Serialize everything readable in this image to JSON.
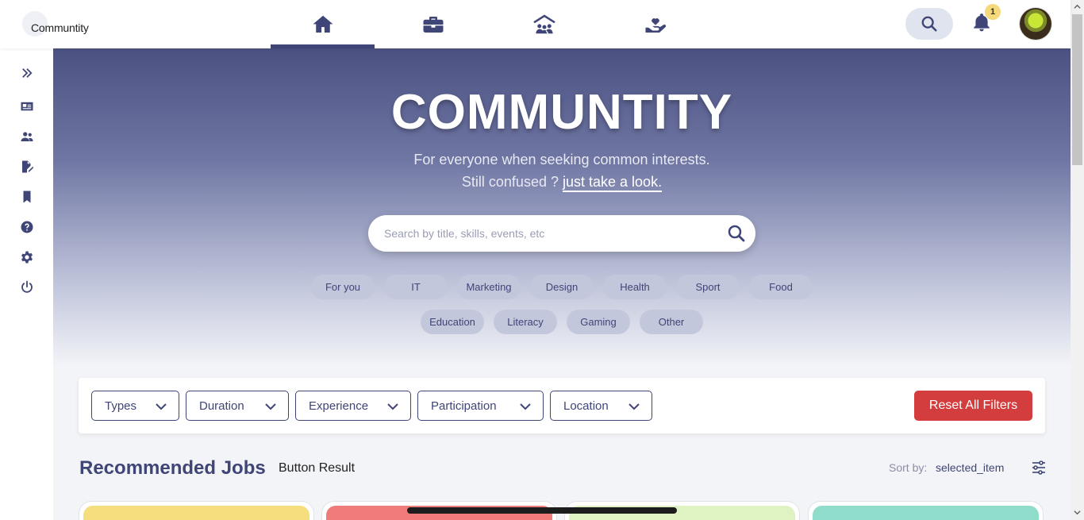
{
  "brand": {
    "name": "Communtity",
    "tagline": ""
  },
  "nav": {
    "items": [
      {
        "name": "home-icon",
        "active": true
      },
      {
        "name": "briefcase-icon",
        "active": false
      },
      {
        "name": "community-icon",
        "active": false
      },
      {
        "name": "volunteer-icon",
        "active": false
      }
    ],
    "notification_count": "1"
  },
  "sidebar": {
    "items": [
      "expand-icon",
      "id-card-icon",
      "users-icon",
      "edit-file-icon",
      "bookmark-icon",
      "help-icon",
      "settings-icon",
      "power-icon"
    ]
  },
  "hero": {
    "title": "COMMUNTITY",
    "subtitle_line1": "For everyone when seeking common interests.",
    "subtitle_line2_prefix": "Still confused ?",
    "subtitle_link": "just take a look.",
    "search_placeholder": "Search by title, skills, events, etc",
    "chips_row1": [
      "For you",
      "IT",
      "Marketing",
      "Design",
      "Health",
      "Sport",
      "Food"
    ],
    "chips_row2": [
      "Education",
      "Literacy",
      "Gaming",
      "Other"
    ]
  },
  "filters": {
    "items": [
      "Types",
      "Duration",
      "Experience",
      "Participation",
      "Location"
    ],
    "reset_label": "Reset All Filters"
  },
  "section": {
    "title": "Recommended Jobs",
    "subtitle": "Button Result",
    "sort_label": "Sort by:",
    "sort_value": "selected_item"
  },
  "colors": {
    "primary": "#3f4577",
    "danger": "#d43d3d",
    "card_colors": [
      "#f6dd7e",
      "#ef7b7b",
      "#dff3c2",
      "#8fdccb"
    ]
  }
}
